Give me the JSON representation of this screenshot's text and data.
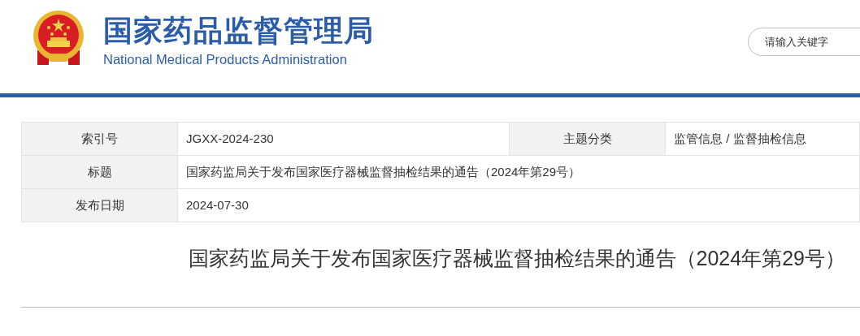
{
  "header": {
    "title": "国家药品监督管理局",
    "subtitle": "National Medical Products Administration",
    "search": {
      "placeholder": "请输入关键字"
    }
  },
  "info_table": {
    "rows": [
      {
        "cells": [
          {
            "kind": "label",
            "text": "索引号"
          },
          {
            "kind": "value",
            "text": "JGXX-2024-230"
          },
          {
            "kind": "label",
            "text": "主题分类"
          },
          {
            "kind": "value",
            "text": "监管信息 / 监督抽检信息"
          }
        ]
      },
      {
        "cells": [
          {
            "kind": "label",
            "text": "标题"
          },
          {
            "kind": "value",
            "text": "国家药监局关于发布国家医疗器械监督抽检结果的通告（2024年第29号）"
          }
        ]
      },
      {
        "cells": [
          {
            "kind": "label",
            "text": "发布日期"
          },
          {
            "kind": "value",
            "text": "2024-07-30"
          }
        ]
      }
    ]
  },
  "article": {
    "title": "国家药监局关于发布国家医疗器械监督抽检结果的通告（2024年第29号）"
  }
}
